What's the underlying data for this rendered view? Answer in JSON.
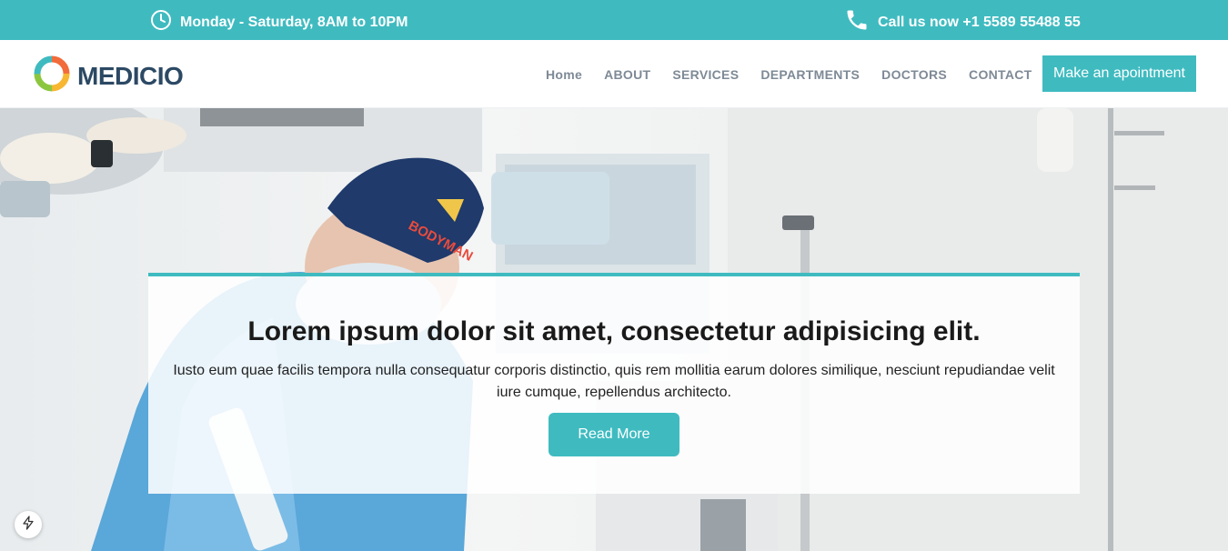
{
  "topbar": {
    "hours": "Monday - Saturday, 8AM to 10PM",
    "phone": "Call us now +1 5589 55488 55",
    "hours_icon": "clock-icon",
    "phone_icon": "phone-icon"
  },
  "header": {
    "logo": "MEDICIO",
    "nav": [
      "Home",
      "ABOUT",
      "SERVICES",
      "DEPARTMENTS",
      "DOCTORS",
      "CONTACT"
    ],
    "cta": "Make an apointment"
  },
  "hero": {
    "title": "Lorem ipsum dolor sit amet, consectetur adipisicing elit.",
    "text": "Iusto eum quae facilis tempora nulla consequatur corporis distinctio, quis rem mollitia earum dolores similique, nesciunt repudiandae velit iure cumque, repellendus architecto.",
    "button": "Read More",
    "cap_label": "BODYMAN"
  },
  "colors": {
    "accent": "#3fbbc0",
    "heading": "#2c4964",
    "nav_text": "#7e8a96"
  },
  "badge_icon": "lightning-icon"
}
